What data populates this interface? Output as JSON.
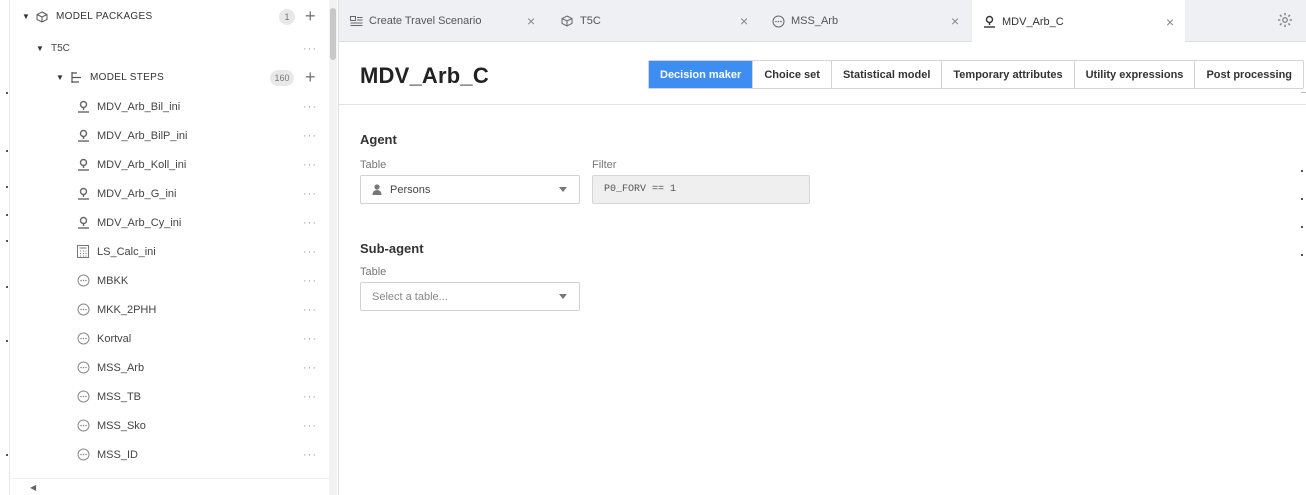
{
  "sidebar": {
    "model_packages": {
      "label": "MODEL PACKAGES",
      "count": "1"
    },
    "project": {
      "label": "T5C",
      "more": "···"
    },
    "model_steps": {
      "label": "MODEL STEPS",
      "count": "160"
    },
    "items": [
      {
        "label": "MDV_Arb_Bil_ini",
        "icon": "location-person-icon"
      },
      {
        "label": "MDV_Arb_BilP_ini",
        "icon": "location-person-icon"
      },
      {
        "label": "MDV_Arb_Koll_ini",
        "icon": "location-person-icon"
      },
      {
        "label": "MDV_Arb_G_ini",
        "icon": "location-person-icon"
      },
      {
        "label": "MDV_Arb_Cy_ini",
        "icon": "location-person-icon"
      },
      {
        "label": "LS_Calc_ini",
        "icon": "calculator-icon"
      },
      {
        "label": "MBKK",
        "icon": "circle-dots-icon"
      },
      {
        "label": "MKK_2PHH",
        "icon": "circle-dots-icon"
      },
      {
        "label": "Kortval",
        "icon": "circle-dots-icon"
      },
      {
        "label": "MSS_Arb",
        "icon": "circle-dots-icon"
      },
      {
        "label": "MSS_TB",
        "icon": "circle-dots-icon"
      },
      {
        "label": "MSS_Sko",
        "icon": "circle-dots-icon"
      },
      {
        "label": "MSS_ID",
        "icon": "circle-dots-icon"
      }
    ],
    "more": "···"
  },
  "tabs": [
    {
      "label": "Create Travel Scenario",
      "icon": "scenario-icon"
    },
    {
      "label": "T5C",
      "icon": "package-icon"
    },
    {
      "label": "MSS_Arb",
      "icon": "circle-dots-icon"
    },
    {
      "label": "MDV_Arb_C",
      "icon": "location-person-icon"
    }
  ],
  "page": {
    "title": "MDV_Arb_C",
    "steps": [
      "Decision maker",
      "Choice set",
      "Statistical model",
      "Temporary attributes",
      "Utility expressions",
      "Post processing"
    ],
    "active_step": "Decision maker"
  },
  "agent": {
    "heading": "Agent",
    "table_label": "Table",
    "table_value": "Persons",
    "filter_label": "Filter",
    "filter_value": "P0_FORV == 1"
  },
  "sub_agent": {
    "heading": "Sub-agent",
    "table_label": "Table",
    "table_placeholder": "Select a table..."
  },
  "colors": {
    "accent": "#3d8ef0",
    "tabbar": "#eef0f3"
  }
}
